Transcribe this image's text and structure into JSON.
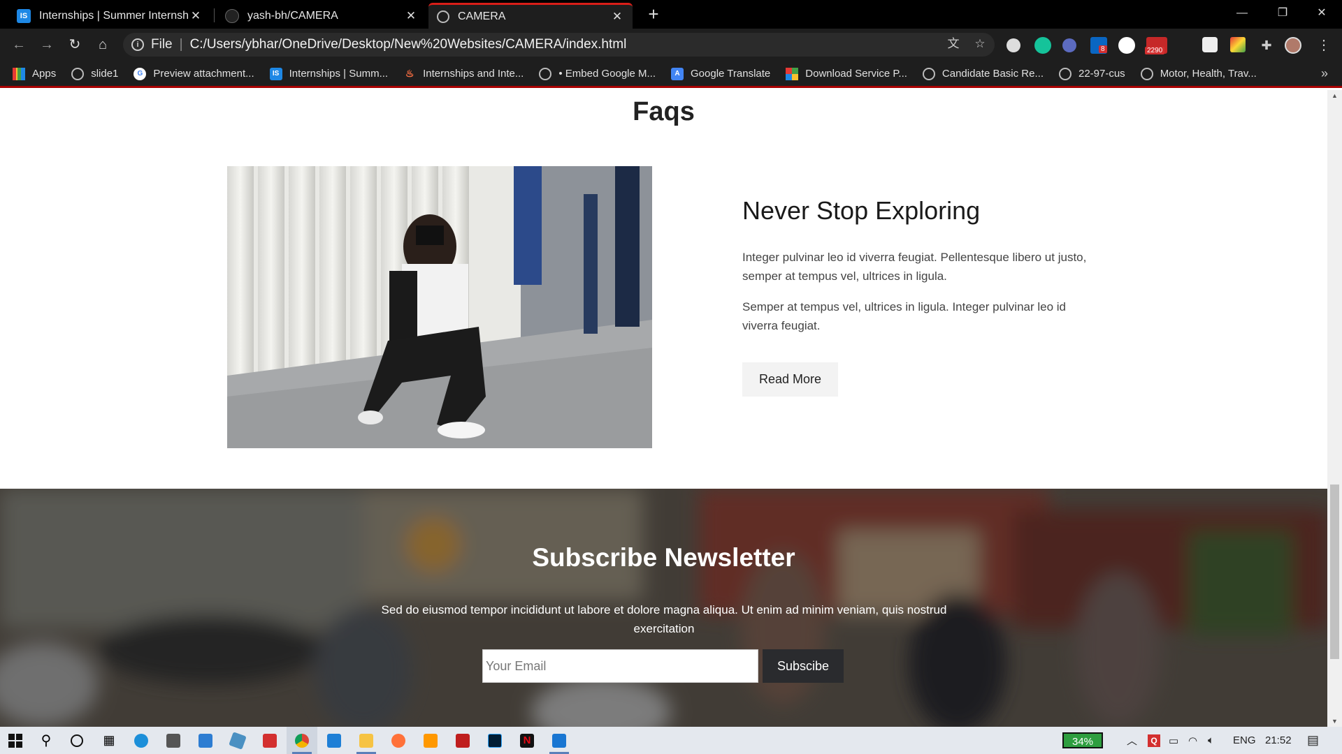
{
  "browser": {
    "tabs": [
      {
        "title": "Internships | Summer Internship",
        "favicon": "IS",
        "active": false
      },
      {
        "title": "yash-bh/CAMERA",
        "favicon": "github-icon",
        "active": false
      },
      {
        "title": "CAMERA",
        "favicon": "globe-icon",
        "active": true
      }
    ],
    "new_tab": "+",
    "address": {
      "scheme_label": "File",
      "url": "C:/Users/ybhar/OneDrive/Desktop/New%20Websites/CAMERA/index.html"
    },
    "extension_badges": {
      "linkedin": "8",
      "mail": "2290"
    },
    "bookmarks": [
      {
        "label": "Apps",
        "icon": "apps-grid-icon"
      },
      {
        "label": "slide1",
        "icon": "globe-icon"
      },
      {
        "label": "Preview attachment...",
        "icon": "google-icon"
      },
      {
        "label": "Internships | Summ...",
        "icon": "IS"
      },
      {
        "label": "Internships and Inte...",
        "icon": "flame-icon"
      },
      {
        "label": "• Embed Google M...",
        "icon": "globe-icon"
      },
      {
        "label": "Google Translate",
        "icon": "translate-icon"
      },
      {
        "label": "Download Service P...",
        "icon": "windows-icon"
      },
      {
        "label": "Candidate Basic Re...",
        "icon": "globe-icon"
      },
      {
        "label": "22-97-cus",
        "icon": "globe-icon"
      },
      {
        "label": "Motor, Health, Trav...",
        "icon": "globe-icon"
      }
    ],
    "bookmarks_more": "»"
  },
  "page": {
    "section_title": "Faqs",
    "feature": {
      "heading": "Never Stop Exploring",
      "paragraph1": "Integer pulvinar leo id viverra feugiat. Pellentesque libero ut justo, semper at tempus vel, ultrices in ligula.",
      "paragraph2": "Semper at tempus vel, ultrices in ligula. Integer pulvinar leo id viverra feugiat.",
      "button": "Read More"
    },
    "newsletter": {
      "title": "Subscribe Newsletter",
      "text": "Sed do eiusmod tempor incididunt ut labore et dolore magna aliqua. Ut enim ad minim veniam, quis nostrud exercitation",
      "input_placeholder": "Your Email",
      "button": "Subscibe"
    }
  },
  "taskbar": {
    "battery": "34%",
    "language": "ENG",
    "time": "21:52"
  },
  "colors": {
    "tab_accent": "#d91e18",
    "chrome_dark": "#1e1e1e",
    "button_dark": "#2a2b2e",
    "battery_green": "#2e9e3f"
  }
}
